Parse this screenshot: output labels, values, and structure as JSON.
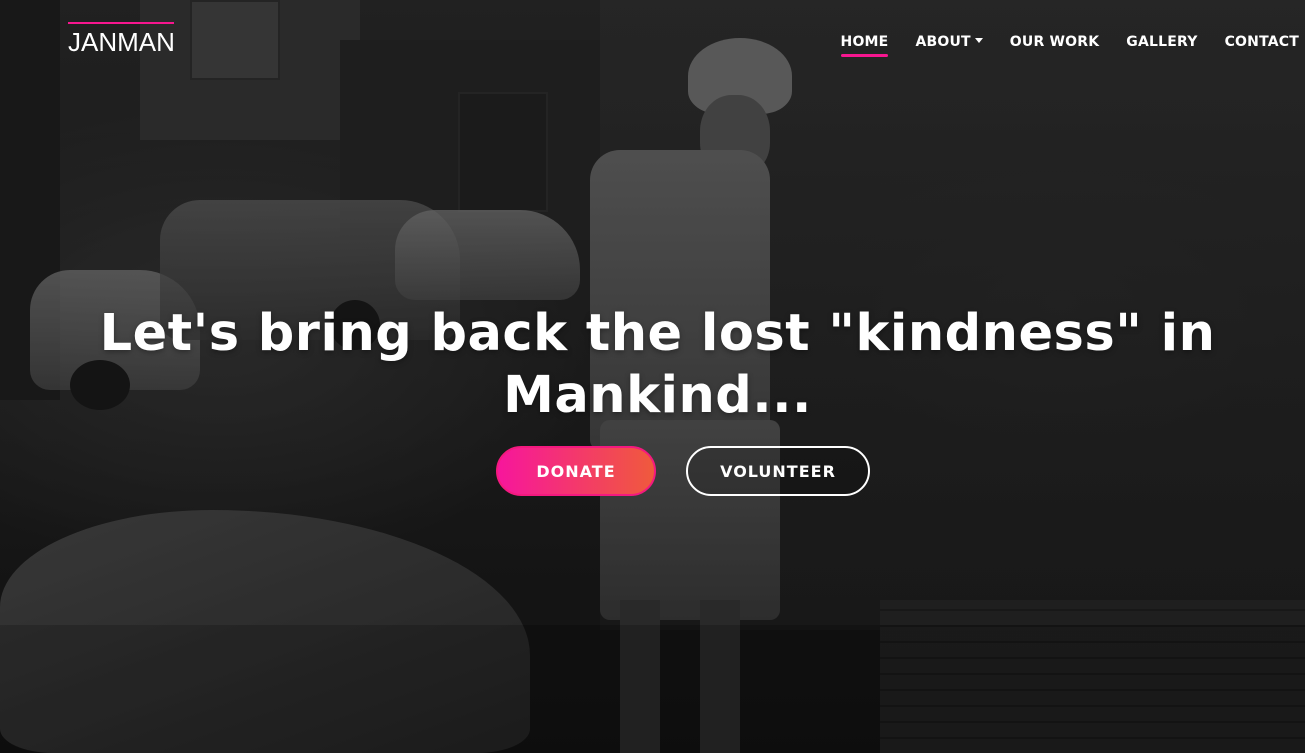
{
  "brand": {
    "name": "JANMAN",
    "accent_color": "#f7168f"
  },
  "nav": {
    "items": [
      {
        "label": "HOME",
        "active": true
      },
      {
        "label": "ABOUT",
        "dropdown": true
      },
      {
        "label": "OUR WORK"
      },
      {
        "label": "GALLERY"
      },
      {
        "label": "CONTACT"
      }
    ]
  },
  "hero": {
    "title_line1": "Let's bring back the lost \"kindness\" in",
    "title_line2": "Mankind...",
    "donate_label": "DONATE",
    "volunteer_label": "VOLUNTEER",
    "donate_gradient": [
      "#f7169c",
      "#f05a3c"
    ],
    "background_description_icon": "grayscale-photo-background"
  }
}
